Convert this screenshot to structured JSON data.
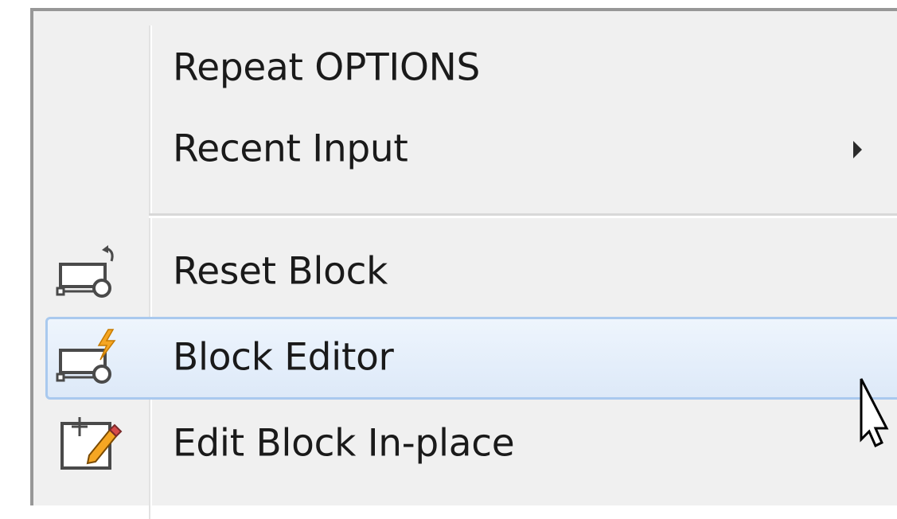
{
  "context_menu": {
    "items": [
      {
        "label": "Repeat OPTIONS",
        "icon": "",
        "has_submenu": false,
        "highlighted": false
      },
      {
        "label": "Recent Input",
        "icon": "",
        "has_submenu": true,
        "highlighted": false
      },
      {
        "label": "Reset Block",
        "icon": "reset-block-icon",
        "has_submenu": false,
        "highlighted": false
      },
      {
        "label": "Block Editor",
        "icon": "block-editor-icon",
        "has_submenu": false,
        "highlighted": true
      },
      {
        "label": "Edit Block In-place",
        "icon": "edit-block-in-place-icon",
        "has_submenu": false,
        "highlighted": false
      }
    ]
  },
  "colors": {
    "menu_background": "#f0f0f0",
    "highlight_border": "#a9c9ee",
    "text": "#1a1a1a",
    "icon_accent": "#f5a623"
  }
}
